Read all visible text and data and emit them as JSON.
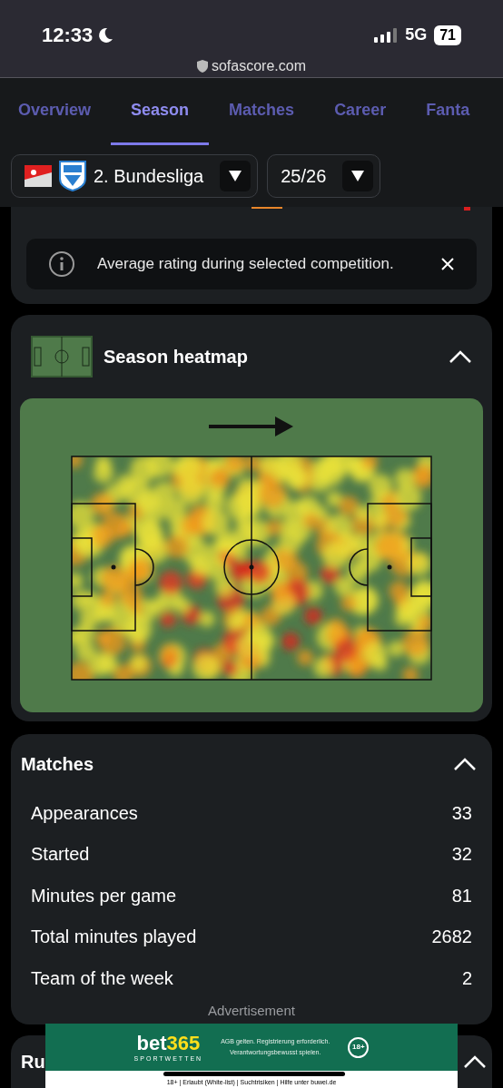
{
  "status_bar": {
    "time": "12:33",
    "network": "5G",
    "battery": "71"
  },
  "browser": {
    "url": "sofascore.com"
  },
  "tabs": [
    {
      "label": "Overview",
      "selected": false
    },
    {
      "label": "Season",
      "selected": true
    },
    {
      "label": "Matches",
      "selected": false
    },
    {
      "label": "Career",
      "selected": false
    },
    {
      "label": "Fanta",
      "selected": false
    }
  ],
  "filters": [
    {
      "kind": "competition",
      "label": "2. Bundesliga"
    },
    {
      "kind": "season",
      "label": "25/26"
    }
  ],
  "info_banner": {
    "text": "Average rating during selected competition."
  },
  "heatmap": {
    "title": "Season heatmap",
    "expanded": true
  },
  "matches": {
    "title": "Matches",
    "expanded": true,
    "rows": [
      {
        "label": "Appearances",
        "value": "33"
      },
      {
        "label": "Started",
        "value": "32"
      },
      {
        "label": "Minutes per game",
        "value": "81"
      },
      {
        "label": "Total minutes played",
        "value": "2682"
      },
      {
        "label": "Team of the week",
        "value": "2"
      }
    ]
  },
  "advertisement_label": "Advertisement",
  "next_section": {
    "title": "Ru",
    "expanded": true
  },
  "ad": {
    "brand": [
      "bet",
      "365"
    ],
    "tagline": "SPORTWETTEN",
    "notice": [
      "AGB gelten. Registrierung erforderlich.",
      "Verantwortungsbewusst spielen."
    ],
    "age": "18+",
    "footer": "18+ | Erlaubt (White-list) | Suchtrisiken | Hilfe unter buwei.de"
  }
}
